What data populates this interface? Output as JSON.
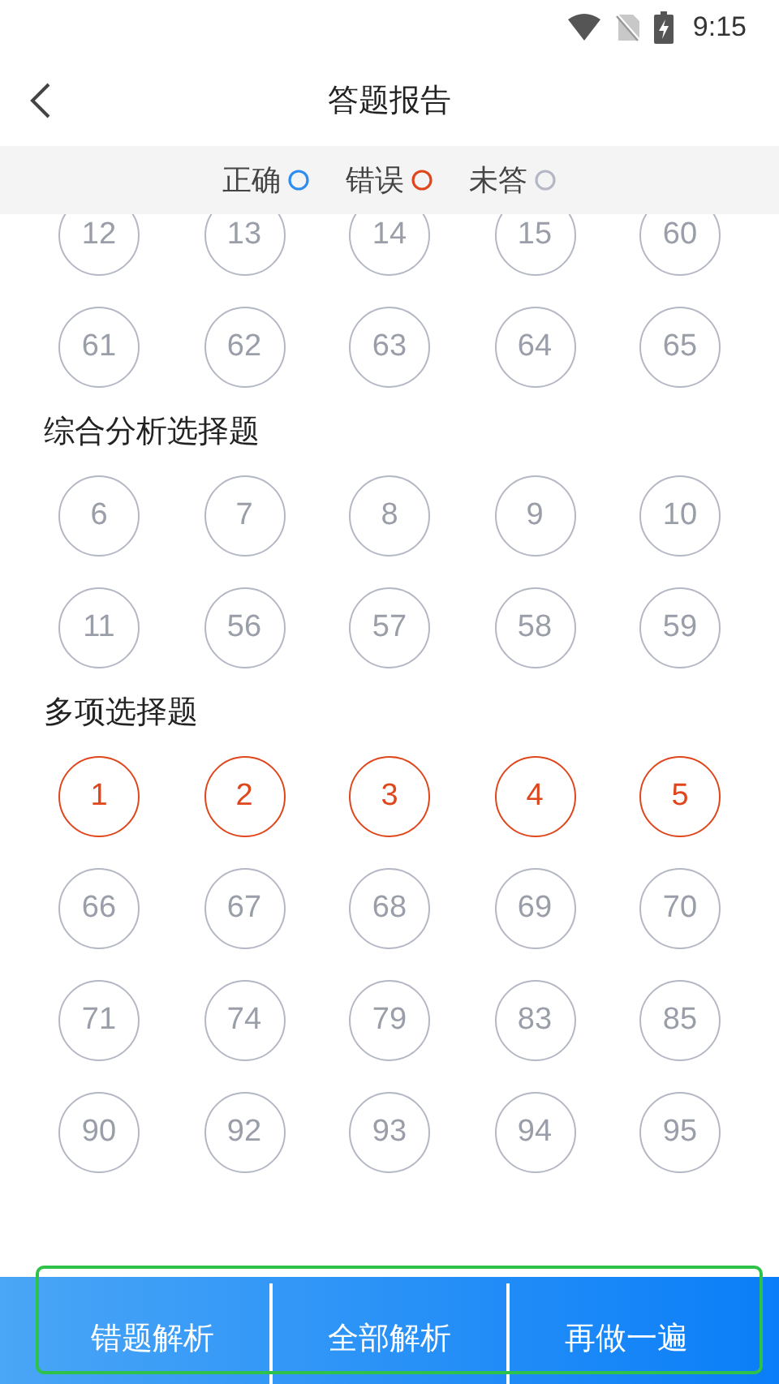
{
  "status_bar": {
    "time": "9:15"
  },
  "header": {
    "title": "答题报告"
  },
  "legend": [
    {
      "label": "正确",
      "kind": "correct"
    },
    {
      "label": "错误",
      "kind": "wrong"
    },
    {
      "label": "未答",
      "kind": "unanswered"
    }
  ],
  "sections": [
    {
      "items": [
        {
          "label": "12",
          "kind": "unanswered"
        },
        {
          "label": "13",
          "kind": "unanswered"
        },
        {
          "label": "14",
          "kind": "unanswered"
        },
        {
          "label": "15",
          "kind": "unanswered"
        },
        {
          "label": "60",
          "kind": "unanswered"
        },
        {
          "label": "61",
          "kind": "unanswered"
        },
        {
          "label": "62",
          "kind": "unanswered"
        },
        {
          "label": "63",
          "kind": "unanswered"
        },
        {
          "label": "64",
          "kind": "unanswered"
        },
        {
          "label": "65",
          "kind": "unanswered"
        }
      ]
    },
    {
      "title": "综合分析选择题",
      "items": [
        {
          "label": "6",
          "kind": "unanswered"
        },
        {
          "label": "7",
          "kind": "unanswered"
        },
        {
          "label": "8",
          "kind": "unanswered"
        },
        {
          "label": "9",
          "kind": "unanswered"
        },
        {
          "label": "10",
          "kind": "unanswered"
        },
        {
          "label": "11",
          "kind": "unanswered"
        },
        {
          "label": "56",
          "kind": "unanswered"
        },
        {
          "label": "57",
          "kind": "unanswered"
        },
        {
          "label": "58",
          "kind": "unanswered"
        },
        {
          "label": "59",
          "kind": "unanswered"
        }
      ]
    },
    {
      "title": "多项选择题",
      "items": [
        {
          "label": "1",
          "kind": "wrong"
        },
        {
          "label": "2",
          "kind": "wrong"
        },
        {
          "label": "3",
          "kind": "wrong"
        },
        {
          "label": "4",
          "kind": "wrong"
        },
        {
          "label": "5",
          "kind": "wrong"
        },
        {
          "label": "66",
          "kind": "unanswered"
        },
        {
          "label": "67",
          "kind": "unanswered"
        },
        {
          "label": "68",
          "kind": "unanswered"
        },
        {
          "label": "69",
          "kind": "unanswered"
        },
        {
          "label": "70",
          "kind": "unanswered"
        },
        {
          "label": "71",
          "kind": "unanswered"
        },
        {
          "label": "74",
          "kind": "unanswered"
        },
        {
          "label": "79",
          "kind": "unanswered"
        },
        {
          "label": "83",
          "kind": "unanswered"
        },
        {
          "label": "85",
          "kind": "unanswered"
        },
        {
          "label": "90",
          "kind": "unanswered"
        },
        {
          "label": "92",
          "kind": "unanswered"
        },
        {
          "label": "93",
          "kind": "unanswered"
        },
        {
          "label": "94",
          "kind": "unanswered"
        },
        {
          "label": "95",
          "kind": "unanswered"
        }
      ]
    }
  ],
  "bottom_bar": {
    "buttons": [
      "错题解析",
      "全部解析",
      "再做一遍"
    ]
  }
}
